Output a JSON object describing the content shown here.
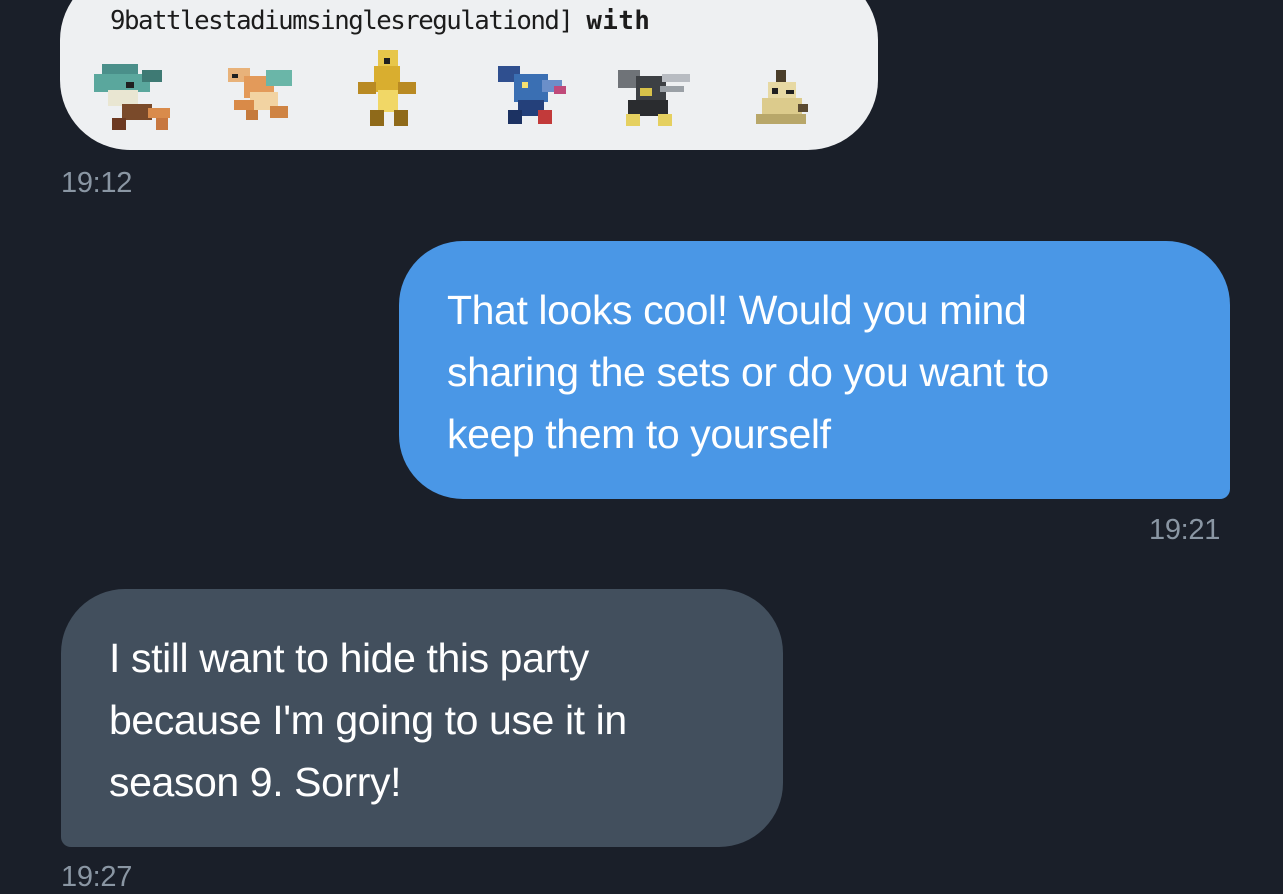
{
  "messages": [
    {
      "type": "image",
      "direction": "incoming",
      "format_text": "9battlestadiumsinglesregulationd]",
      "format_with": "with",
      "sprites": [
        "pokemon-sprite-1-icon",
        "dragonite-sprite-icon",
        "pokemon-sprite-3-icon",
        "pokemon-sprite-4-icon",
        "pokemon-sprite-5-icon",
        "mimikyu-sprite-icon"
      ],
      "time": "19:12"
    },
    {
      "type": "text",
      "direction": "outgoing",
      "lines": [
        "That looks cool! Would you mind",
        "sharing the sets or do you want to",
        "keep them to yourself"
      ],
      "time": "19:21"
    },
    {
      "type": "text",
      "direction": "incoming",
      "lines": [
        "I still want to hide this party",
        "because I'm going to use it in",
        "season 9. Sorry!"
      ],
      "time": "19:27"
    }
  ],
  "colors": {
    "background": "#1a1f29",
    "outgoing_bubble": "#4a97e6",
    "incoming_bubble": "#424f5d",
    "timestamp": "#8a96a3"
  }
}
